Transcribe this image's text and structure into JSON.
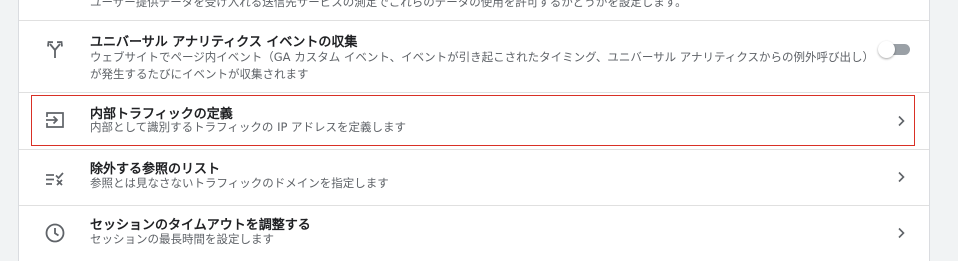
{
  "top_row": {
    "desc": "ユーザー提供データを受け入れる送信先サービスの測定でこれらのデータの使用を許可するかどうかを設定します。"
  },
  "rows": [
    {
      "title": "ユニバーサル アナリティクス イベントの収集",
      "desc": "ウェブサイトでページ内イベント（GA カスタム イベント、イベントが引き起こされたタイミング、ユニバーサル アナリティクスからの例外呼び出し）が発生するたびにイベントが収集されます",
      "icon": "merge-arrows-icon",
      "control": "toggle",
      "toggle_on": false
    },
    {
      "title": "内部トラフィックの定義",
      "desc": "内部として識別するトラフィックの IP アドレスを定義します",
      "icon": "login-arrow-icon",
      "control": "chevron",
      "highlighted": true
    },
    {
      "title": "除外する参照のリスト",
      "desc": "参照とは見なさないトラフィックのドメインを指定します",
      "icon": "exclude-list-icon",
      "control": "chevron"
    },
    {
      "title": "セッションのタイムアウトを調整する",
      "desc": "セッションの最長時間を設定します",
      "icon": "clock-icon",
      "control": "chevron"
    }
  ],
  "colors": {
    "highlight_border": "#d93025",
    "text_primary": "#202124",
    "text_secondary": "#5f6368",
    "toggle_track": "#9aa0a6"
  }
}
